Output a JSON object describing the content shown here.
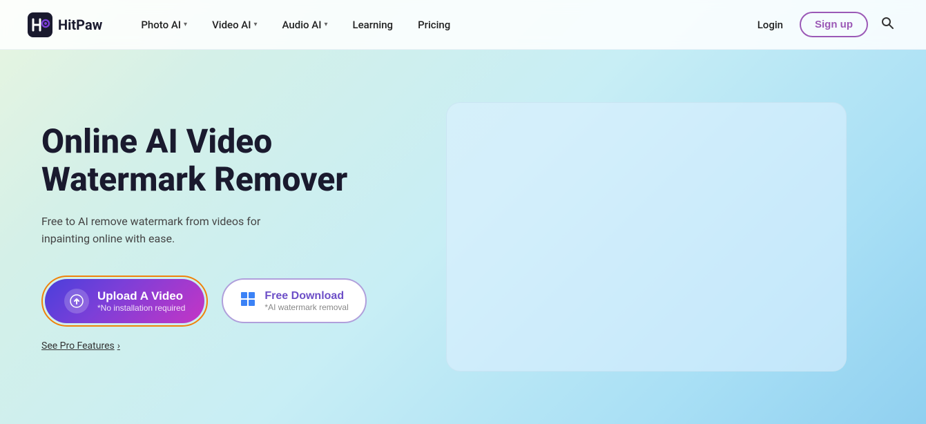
{
  "logo": {
    "text": "HitPaw"
  },
  "nav": {
    "items": [
      {
        "label": "Photo AI",
        "has_dropdown": true
      },
      {
        "label": "Video AI",
        "has_dropdown": true
      },
      {
        "label": "Audio AI",
        "has_dropdown": true
      },
      {
        "label": "Learning",
        "has_dropdown": false
      },
      {
        "label": "Pricing",
        "has_dropdown": false
      }
    ],
    "login_label": "Login",
    "signup_label": "Sign up"
  },
  "hero": {
    "title_line1": "Online AI Video",
    "title_line2": "Watermark Remover",
    "subtitle": "Free to AI remove watermark from videos for\ninpainting online with ease.",
    "upload_btn_main": "Upload A Video",
    "upload_btn_sub": "*No installation required",
    "download_btn_main": "Free Download",
    "download_btn_sub": "*AI watermark removal",
    "see_pro_label": "See Pro Features"
  },
  "colors": {
    "accent_purple": "#6d4fc7",
    "accent_orange": "#f0820a",
    "gradient_start": "#4a3fdb",
    "gradient_end": "#c535c5"
  }
}
